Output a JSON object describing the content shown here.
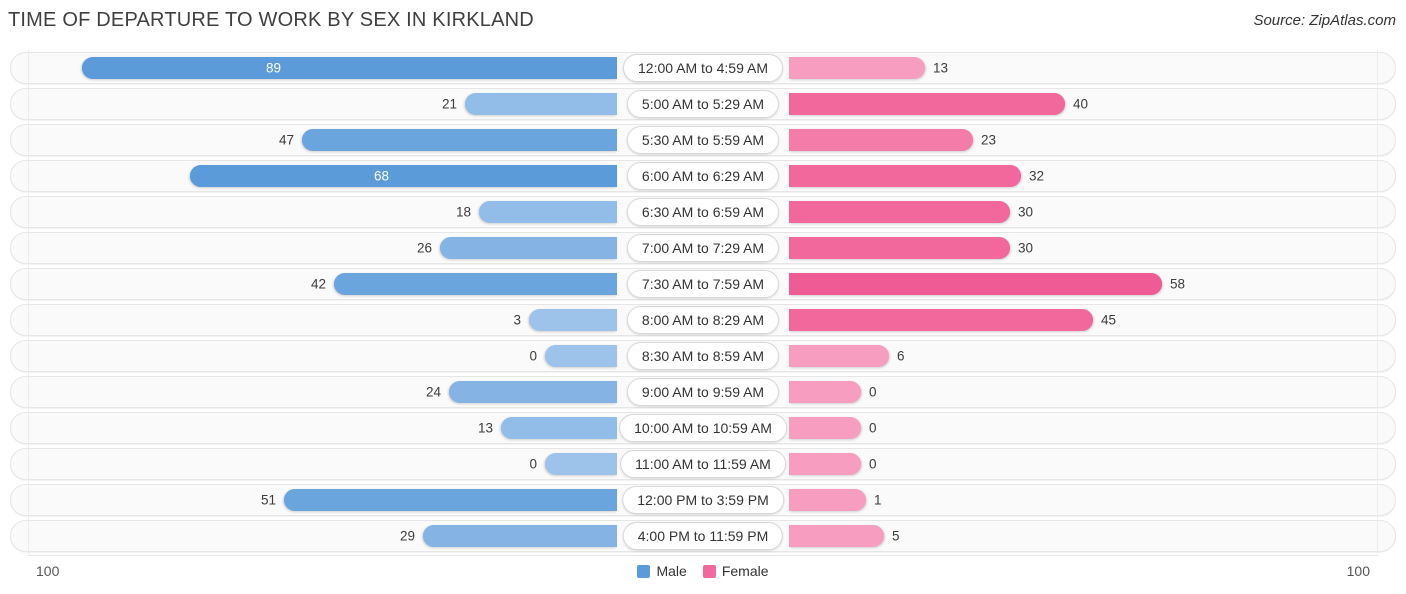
{
  "header": {
    "title": "TIME OF DEPARTURE TO WORK BY SEX IN KIRKLAND",
    "source": "Source: ZipAtlas.com"
  },
  "legend": {
    "male_label": "Male",
    "female_label": "Female",
    "male_color": "#5b9bd9",
    "female_color": "#f2689c"
  },
  "axis": {
    "left_label": "100",
    "right_label": "100"
  },
  "chart_data": {
    "type": "bar",
    "orientation": "horizontal-diverging",
    "title": "TIME OF DEPARTURE TO WORK BY SEX IN KIRKLAND",
    "xlabel": "",
    "ylabel": "",
    "xlim": [
      100,
      100
    ],
    "grid": false,
    "legend_position": "bottom-center",
    "categories": [
      "12:00 AM to 4:59 AM",
      "5:00 AM to 5:29 AM",
      "5:30 AM to 5:59 AM",
      "6:00 AM to 6:29 AM",
      "6:30 AM to 6:59 AM",
      "7:00 AM to 7:29 AM",
      "7:30 AM to 7:59 AM",
      "8:00 AM to 8:29 AM",
      "8:30 AM to 8:59 AM",
      "9:00 AM to 9:59 AM",
      "10:00 AM to 10:59 AM",
      "11:00 AM to 11:59 AM",
      "12:00 PM to 3:59 PM",
      "4:00 PM to 11:59 PM"
    ],
    "series": [
      {
        "name": "Male",
        "color": "#5b9bd9",
        "values": [
          89,
          21,
          47,
          68,
          18,
          26,
          42,
          3,
          0,
          24,
          13,
          0,
          51,
          29
        ]
      },
      {
        "name": "Female",
        "color": "#f2689c",
        "values": [
          13,
          40,
          23,
          32,
          30,
          30,
          58,
          45,
          6,
          0,
          0,
          0,
          1,
          5
        ]
      }
    ]
  },
  "rows": [
    {
      "label": "12:00 AM to 4:59 AM",
      "male": "89",
      "female": "13",
      "male_w": 535,
      "female_w": 136,
      "male_shade": "#5b9bd9",
      "female_shade": "#f79ec0",
      "male_inside": true,
      "female_inside": false
    },
    {
      "label": "5:00 AM to 5:29 AM",
      "male": "21",
      "female": "40",
      "male_w": 152,
      "female_w": 276,
      "male_shade": "#92bde8",
      "female_shade": "#f2689c",
      "male_inside": false,
      "female_inside": false
    },
    {
      "label": "5:30 AM to 5:59 AM",
      "male": "47",
      "female": "23",
      "male_w": 315,
      "female_w": 184,
      "male_shade": "#6ba5dd",
      "female_shade": "#f47ca9",
      "male_inside": false,
      "female_inside": false
    },
    {
      "label": "6:00 AM to 6:29 AM",
      "male": "68",
      "female": "32",
      "male_w": 427,
      "female_w": 232,
      "male_shade": "#5b9bd9",
      "female_shade": "#f2689c",
      "male_inside": true,
      "female_inside": false
    },
    {
      "label": "6:30 AM to 6:59 AM",
      "male": "18",
      "female": "30",
      "male_w": 138,
      "female_w": 221,
      "male_shade": "#92bde8",
      "female_shade": "#f2689c",
      "male_inside": false,
      "female_inside": false
    },
    {
      "label": "7:00 AM to 7:29 AM",
      "male": "26",
      "female": "30",
      "male_w": 177,
      "female_w": 221,
      "male_shade": "#85b4e4",
      "female_shade": "#f2689c",
      "male_inside": false,
      "female_inside": false
    },
    {
      "label": "7:30 AM to 7:59 AM",
      "male": "42",
      "female": "58",
      "male_w": 283,
      "female_w": 373,
      "male_shade": "#6ba5dd",
      "female_shade": "#ef5b94",
      "male_inside": false,
      "female_inside": false
    },
    {
      "label": "8:00 AM to 8:29 AM",
      "male": "3",
      "female": "45",
      "male_w": 88,
      "female_w": 304,
      "male_shade": "#9dc3ea",
      "female_shade": "#f2689c",
      "male_inside": false,
      "female_inside": false
    },
    {
      "label": "8:30 AM to 8:59 AM",
      "male": "0",
      "female": "6",
      "male_w": 72,
      "female_w": 100,
      "male_shade": "#9dc3ea",
      "female_shade": "#f79ec0",
      "male_inside": false,
      "female_inside": false
    },
    {
      "label": "9:00 AM to 9:59 AM",
      "male": "24",
      "female": "0",
      "male_w": 168,
      "female_w": 72,
      "male_shade": "#85b4e4",
      "female_shade": "#f79ec0",
      "male_inside": false,
      "female_inside": false
    },
    {
      "label": "10:00 AM to 10:59 AM",
      "male": "13",
      "female": "0",
      "male_w": 116,
      "female_w": 72,
      "male_shade": "#92bde8",
      "female_shade": "#f79ec0",
      "male_inside": false,
      "female_inside": false
    },
    {
      "label": "11:00 AM to 11:59 AM",
      "male": "0",
      "female": "0",
      "male_w": 72,
      "female_w": 72,
      "male_shade": "#9dc3ea",
      "female_shade": "#f79ec0",
      "male_inside": false,
      "female_inside": false
    },
    {
      "label": "12:00 PM to 3:59 PM",
      "male": "51",
      "female": "1",
      "male_w": 333,
      "female_w": 77,
      "male_shade": "#6ba5dd",
      "female_shade": "#f79ec0",
      "male_inside": false,
      "female_inside": false
    },
    {
      "label": "4:00 PM to 11:59 PM",
      "male": "29",
      "female": "5",
      "male_w": 194,
      "female_w": 95,
      "male_shade": "#85b4e4",
      "female_shade": "#f79ec0",
      "male_inside": false,
      "female_inside": false
    }
  ]
}
